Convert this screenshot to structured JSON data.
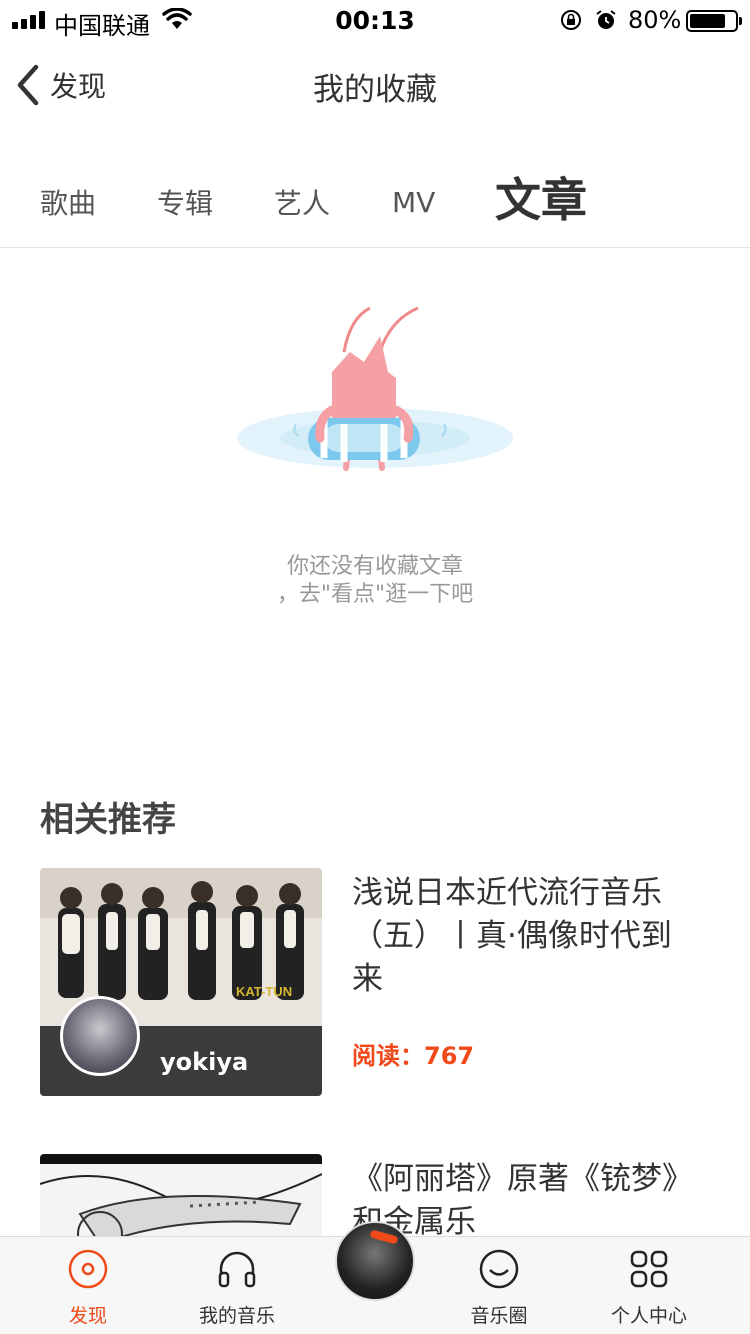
{
  "status_bar": {
    "carrier": "中国联通",
    "time": "00:13",
    "battery_percent": "80%",
    "battery_level": 0.8
  },
  "nav": {
    "back_label": "发现",
    "title": "我的收藏"
  },
  "tabs": [
    {
      "label": "歌曲",
      "active": false
    },
    {
      "label": "专辑",
      "active": false
    },
    {
      "label": "艺人",
      "active": false
    },
    {
      "label": "MV",
      "active": false
    },
    {
      "label": "文章",
      "active": true
    }
  ],
  "empty_state": {
    "line1": "你还没有收藏文章",
    "line2": "，去\"看点\"逛一下吧"
  },
  "recommend": {
    "title": "相关推荐",
    "items": [
      {
        "title": "浅说日本近代流行音乐（五）丨真·偶像时代到来",
        "reads_label": "阅读：",
        "reads": "767",
        "author": "yokiya"
      },
      {
        "title": "《阿丽塔》原著《铳梦》和金属乐"
      }
    ]
  },
  "tab_bar": {
    "items": [
      {
        "label": "发现",
        "icon": "disc-icon",
        "active": true
      },
      {
        "label": "我的音乐",
        "icon": "headphones-icon",
        "active": false
      },
      {
        "label": "音乐圈",
        "icon": "smile-icon",
        "active": false
      },
      {
        "label": "个人中心",
        "icon": "grid-icon",
        "active": false
      }
    ]
  },
  "colors": {
    "accent": "#f04a1a",
    "text": "#333333",
    "muted": "#999999"
  }
}
